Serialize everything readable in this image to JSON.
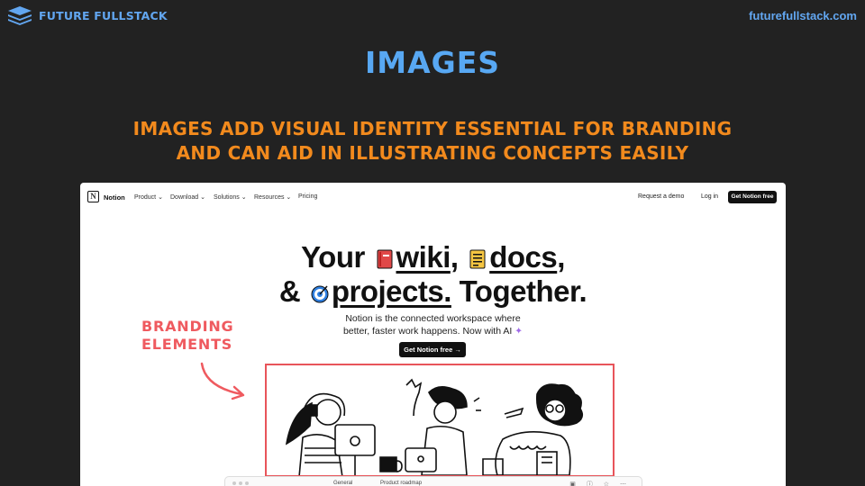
{
  "brand": {
    "name": "FUTURE FULLSTACK",
    "url": "futurefullstack.com",
    "accent": "#62a6f0"
  },
  "slide": {
    "title": "IMAGES",
    "subtitle_line1": "IMAGES ADD VISUAL IDENTITY ESSENTIAL FOR BRANDING",
    "subtitle_line2": "AND CAN AID IN ILLUSTRATING CONCEPTS EASILY",
    "subtitle_color": "#f28a1d"
  },
  "annotation": {
    "line1": "BRANDING",
    "line2": "ELEMENTS",
    "color": "#ef5a5f"
  },
  "notion": {
    "brand": "Notion",
    "nav_items": [
      "Product",
      "Download",
      "Solutions",
      "Resources",
      "Pricing"
    ],
    "request_demo": "Request a demo",
    "login": "Log in",
    "nav_cta": "Get Notion free",
    "hero": {
      "your": "Your",
      "wiki": "wiki",
      "comma1": ",",
      "docs": "docs",
      "comma2": ",",
      "amp": "&",
      "projects": "projects.",
      "together": "Together."
    },
    "desc_line1": "Notion is the connected workspace where",
    "desc_line2": "better, faster work happens. Now with AI",
    "sparkle": "✦",
    "hero_cta": "Get Notion free →",
    "bottom_tab1": "General",
    "bottom_tab2": "Product roadmap",
    "bottom_icons": "▣ ⓘ ☆ ⋯"
  }
}
